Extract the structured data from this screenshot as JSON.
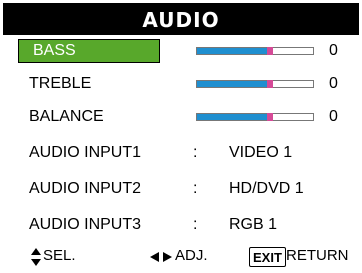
{
  "menu": {
    "title": "AUDIO"
  },
  "sliders": [
    {
      "label": "BASS",
      "value": "0",
      "level": 0.63,
      "selected": true
    },
    {
      "label": "TREBLE",
      "value": "0",
      "level": 0.63,
      "selected": false
    },
    {
      "label": "BALANCE",
      "value": "0",
      "level": 0.63,
      "selected": false
    }
  ],
  "inputs": [
    {
      "label": "AUDIO INPUT1",
      "sep": ":",
      "source": "VIDEO 1"
    },
    {
      "label": "AUDIO INPUT2",
      "sep": ":",
      "source": "HD/DVD 1"
    },
    {
      "label": "AUDIO INPUT3",
      "sep": ":",
      "source": "RGB 1"
    }
  ],
  "guide": {
    "sel_label": "SEL.",
    "adj_label": "ADJ.",
    "exit_key": "EXIT",
    "return_label": "RETURN"
  },
  "colors": {
    "highlight": "#58a82b",
    "bar_fill": "#1f8fd0",
    "bar_marker": "#d54a97",
    "title_bg": "#000000"
  },
  "icons": {
    "sel": "up-down-arrows-icon",
    "adj": "left-right-arrows-icon"
  }
}
